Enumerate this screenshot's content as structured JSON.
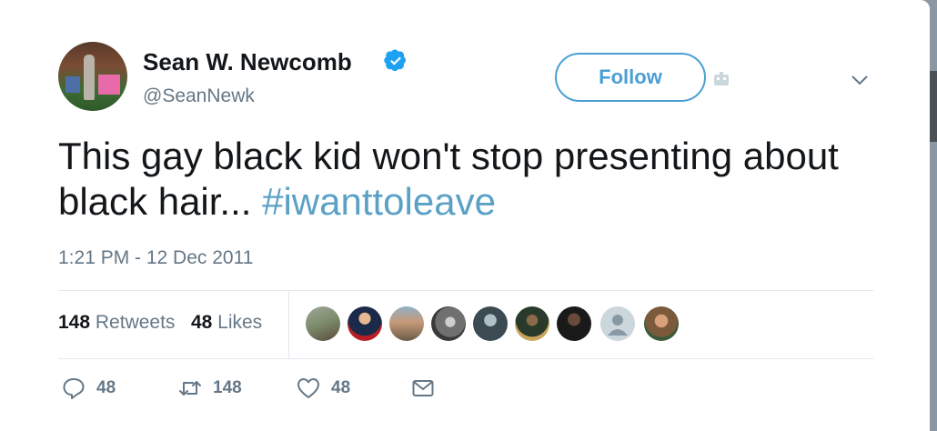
{
  "colors": {
    "accent": "#4a9fd5",
    "hashtag": "#5ba1c5",
    "muted": "#657786",
    "text": "#14171a"
  },
  "author": {
    "name": "Sean W. Newcomb",
    "handle": "@SeanNewk",
    "verified_icon": "verified-badge-icon"
  },
  "header": {
    "follow_label": "Follow"
  },
  "tweet": {
    "text_main": "This gay black kid won't stop presenting about black hair... ",
    "hashtag": "#iwanttoleave"
  },
  "timestamp": "1:21 PM - 12 Dec 2011",
  "stats": {
    "retweets_count": "148",
    "retweets_label": "Retweets",
    "likes_count": "48",
    "likes_label": "Likes"
  },
  "likers": [
    "avatar-1",
    "avatar-2",
    "avatar-3",
    "avatar-4",
    "avatar-5",
    "avatar-6",
    "avatar-7",
    "avatar-8",
    "avatar-9"
  ],
  "actions": {
    "reply_count": "48",
    "retweet_count": "148",
    "like_count": "48"
  }
}
